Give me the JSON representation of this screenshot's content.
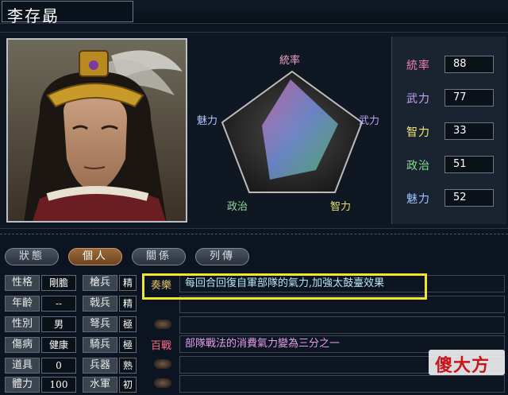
{
  "title": "李存勗",
  "radar": {
    "labels": {
      "top": "統率",
      "right": "武力",
      "bottom_right": "智力",
      "bottom_left": "政治",
      "left": "魅力"
    },
    "colors": {
      "top": "#f0a2c7",
      "right": "#b6a3f0",
      "bottom_right": "#e8e070",
      "bottom_left": "#8fd99c",
      "left": "#a8c8ff"
    }
  },
  "stats": [
    {
      "label": "統率",
      "value": "88",
      "color": "#f07fb0"
    },
    {
      "label": "武力",
      "value": "77",
      "color": "#c8a4f8"
    },
    {
      "label": "智力",
      "value": "33",
      "color": "#f0e670"
    },
    {
      "label": "政治",
      "value": "51",
      "color": "#88d890"
    },
    {
      "label": "魅力",
      "value": "52",
      "color": "#a0c4ff"
    }
  ],
  "tabs": [
    "狀態",
    "個人",
    "關係",
    "列傳"
  ],
  "active_tab": "個人",
  "personal": [
    {
      "label": "性格",
      "value": "剛膽"
    },
    {
      "label": "年齡",
      "value": "--"
    },
    {
      "label": "性別",
      "value": "男"
    },
    {
      "label": "傷病",
      "value": "健康"
    },
    {
      "label": "道具",
      "value": "0"
    },
    {
      "label": "體力",
      "value": "100"
    }
  ],
  "aptitudes": [
    {
      "label": "槍兵",
      "rank": "精"
    },
    {
      "label": "戟兵",
      "rank": "精"
    },
    {
      "label": "弩兵",
      "rank": "極"
    },
    {
      "label": "騎兵",
      "rank": "極"
    },
    {
      "label": "兵器",
      "rank": "熟"
    },
    {
      "label": "水軍",
      "rank": "初"
    }
  ],
  "skills": [
    {
      "name": "奏樂",
      "desc": "每回合回復自軍部隊的氣力,加強太鼓臺效果",
      "name_color": "#e6c36a",
      "desc_color": "#b8e6f8"
    },
    {
      "name": "",
      "desc": "",
      "name_color": "",
      "desc_color": ""
    },
    {
      "name": "",
      "desc": "",
      "name_color": "",
      "desc_color": ""
    },
    {
      "name": "百戰",
      "desc": "部隊戰法的消費氣力變為三分之一",
      "name_color": "#ff6a8a",
      "desc_color": "#e89cf0"
    },
    {
      "name": "",
      "desc": "",
      "name_color": "",
      "desc_color": ""
    },
    {
      "name": "",
      "desc": "",
      "name_color": "",
      "desc_color": ""
    }
  ],
  "watermark": "傻大方"
}
